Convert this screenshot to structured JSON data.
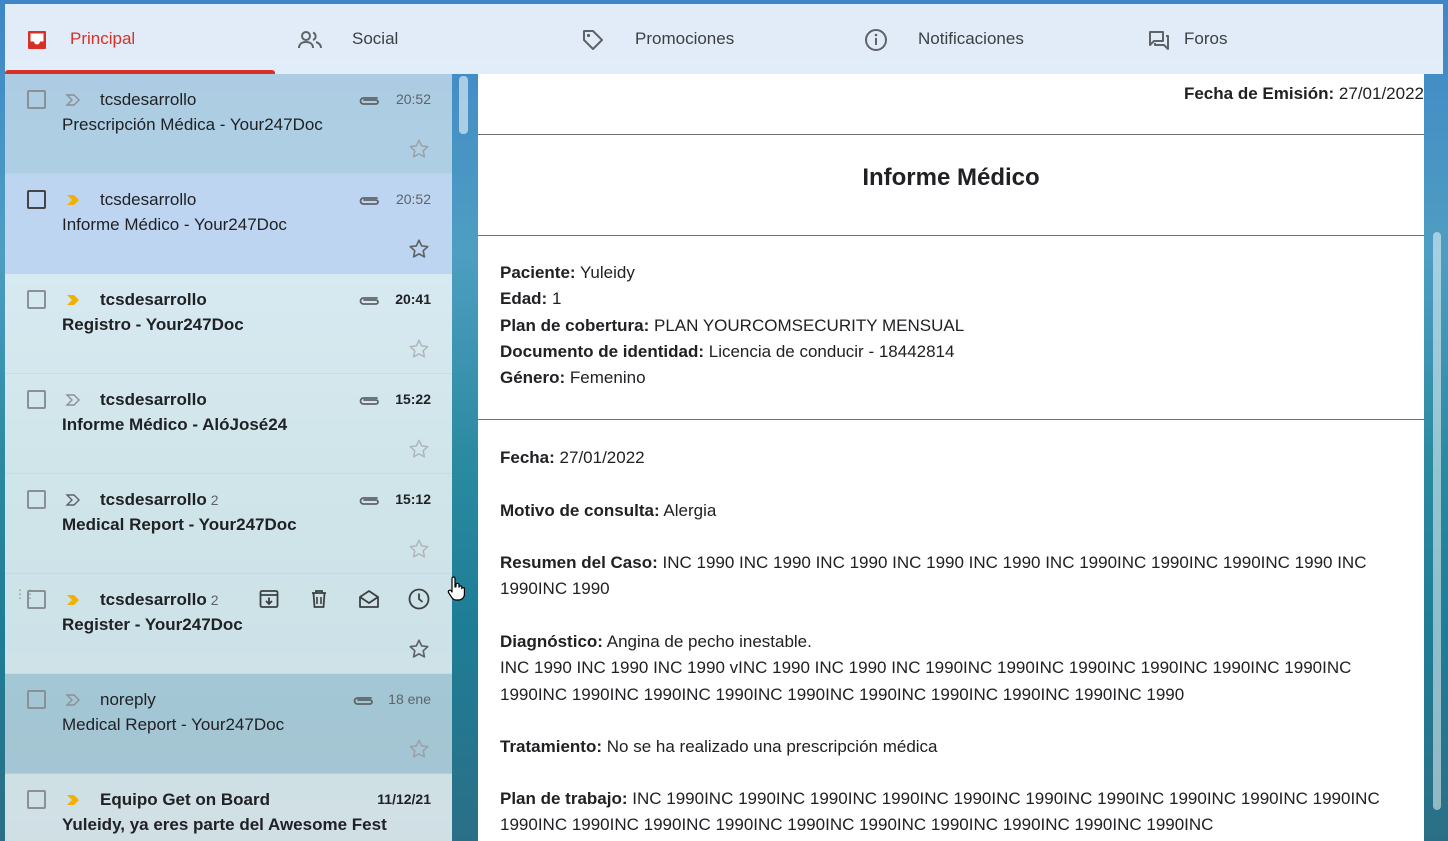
{
  "tabs": [
    {
      "label": "Principal",
      "icon": "inbox-icon",
      "active": true
    },
    {
      "label": "Social",
      "icon": "people-icon",
      "active": false
    },
    {
      "label": "Promociones",
      "icon": "tag-icon",
      "active": false
    },
    {
      "label": "Notificaciones",
      "icon": "info-icon",
      "active": false
    },
    {
      "label": "Foros",
      "icon": "forum-icon",
      "active": false
    }
  ],
  "emails": [
    {
      "sender": "tcsdesarrollo",
      "count": "",
      "subject": "Prescripción Médica - Your247Doc",
      "time": "20:52",
      "unread": false,
      "important": false,
      "attachment": true,
      "selected": false
    },
    {
      "sender": "tcsdesarrollo",
      "count": "",
      "subject": "Informe Médico - Your247Doc",
      "time": "20:52",
      "unread": false,
      "important": true,
      "attachment": true,
      "selected": true
    },
    {
      "sender": "tcsdesarrollo",
      "count": "",
      "subject": "Registro - Your247Doc",
      "time": "20:41",
      "unread": true,
      "important": true,
      "attachment": true,
      "selected": false
    },
    {
      "sender": "tcsdesarrollo",
      "count": "",
      "subject": "Informe Médico - AlóJosé24",
      "time": "15:22",
      "unread": true,
      "important": false,
      "attachment": true,
      "selected": false
    },
    {
      "sender": "tcsdesarrollo",
      "count": "2",
      "subject": "Medical Report - Your247Doc",
      "time": "15:12",
      "unread": true,
      "important": false,
      "attachment": true,
      "selected": false
    },
    {
      "sender": "tcsdesarrollo",
      "count": "2",
      "subject": "Register - Your247Doc",
      "time": "",
      "unread": true,
      "important": true,
      "attachment": false,
      "selected": false,
      "hover": true
    },
    {
      "sender": "noreply",
      "count": "",
      "subject": "Medical Report - Your247Doc",
      "time": "18 ene",
      "unread": false,
      "important": false,
      "attachment": true,
      "selected": false
    },
    {
      "sender": "Equipo Get on Board",
      "count": "",
      "subject": "Yuleidy, ya eres parte del Awesome Fest",
      "time": "11/12/21",
      "unread": true,
      "important": true,
      "attachment": false,
      "selected": false
    }
  ],
  "hover_actions": [
    "archive-icon",
    "delete-icon",
    "mark-read-icon",
    "snooze-icon"
  ],
  "report": {
    "issue_label": "Fecha de Emisión:",
    "issue_value": "27/01/2022",
    "title": "Informe Médico",
    "patient": [
      {
        "label": "Paciente:",
        "value": "Yuleidy"
      },
      {
        "label": "Edad:",
        "value": "1"
      },
      {
        "label": "Plan de cobertura:",
        "value": "PLAN YOURCOMSECURITY MENSUAL"
      },
      {
        "label": "Documento de identidad:",
        "value": "Licencia de conducir - 18442814"
      },
      {
        "label": "Género:",
        "value": "Femenino"
      }
    ],
    "fecha_label": "Fecha:",
    "fecha_value": "27/01/2022",
    "motivo_label": "Motivo de consulta:",
    "motivo_value": "Alergia",
    "resumen_label": "Resumen del Caso:",
    "resumen_value": "INC 1990 INC 1990 INC 1990 INC 1990 INC 1990 INC 1990INC 1990INC 1990INC 1990 INC 1990INC 1990",
    "diag_label": "Diagnóstico:",
    "diag_value": "Angina de pecho inestable.",
    "diag_extra": "INC 1990 INC 1990 INC 1990 vINC 1990 INC 1990 INC 1990INC 1990INC 1990INC 1990INC 1990INC 1990INC 1990INC 1990INC 1990INC 1990INC 1990INC 1990INC 1990INC 1990INC 1990INC 1990",
    "trat_label": "Tratamiento:",
    "trat_value": "No se ha realizado una prescripción médica",
    "plan_label": "Plan de trabajo:",
    "plan_value": "INC 1990INC 1990INC 1990INC 1990INC 1990INC 1990INC 1990INC 1990INC 1990INC 1990INC 1990INC 1990INC 1990INC 1990INC 1990INC 1990INC 1990INC 1990INC 1990INC 1990INC"
  },
  "colors": {
    "accent": "#d93025",
    "important": "#f2b000"
  }
}
